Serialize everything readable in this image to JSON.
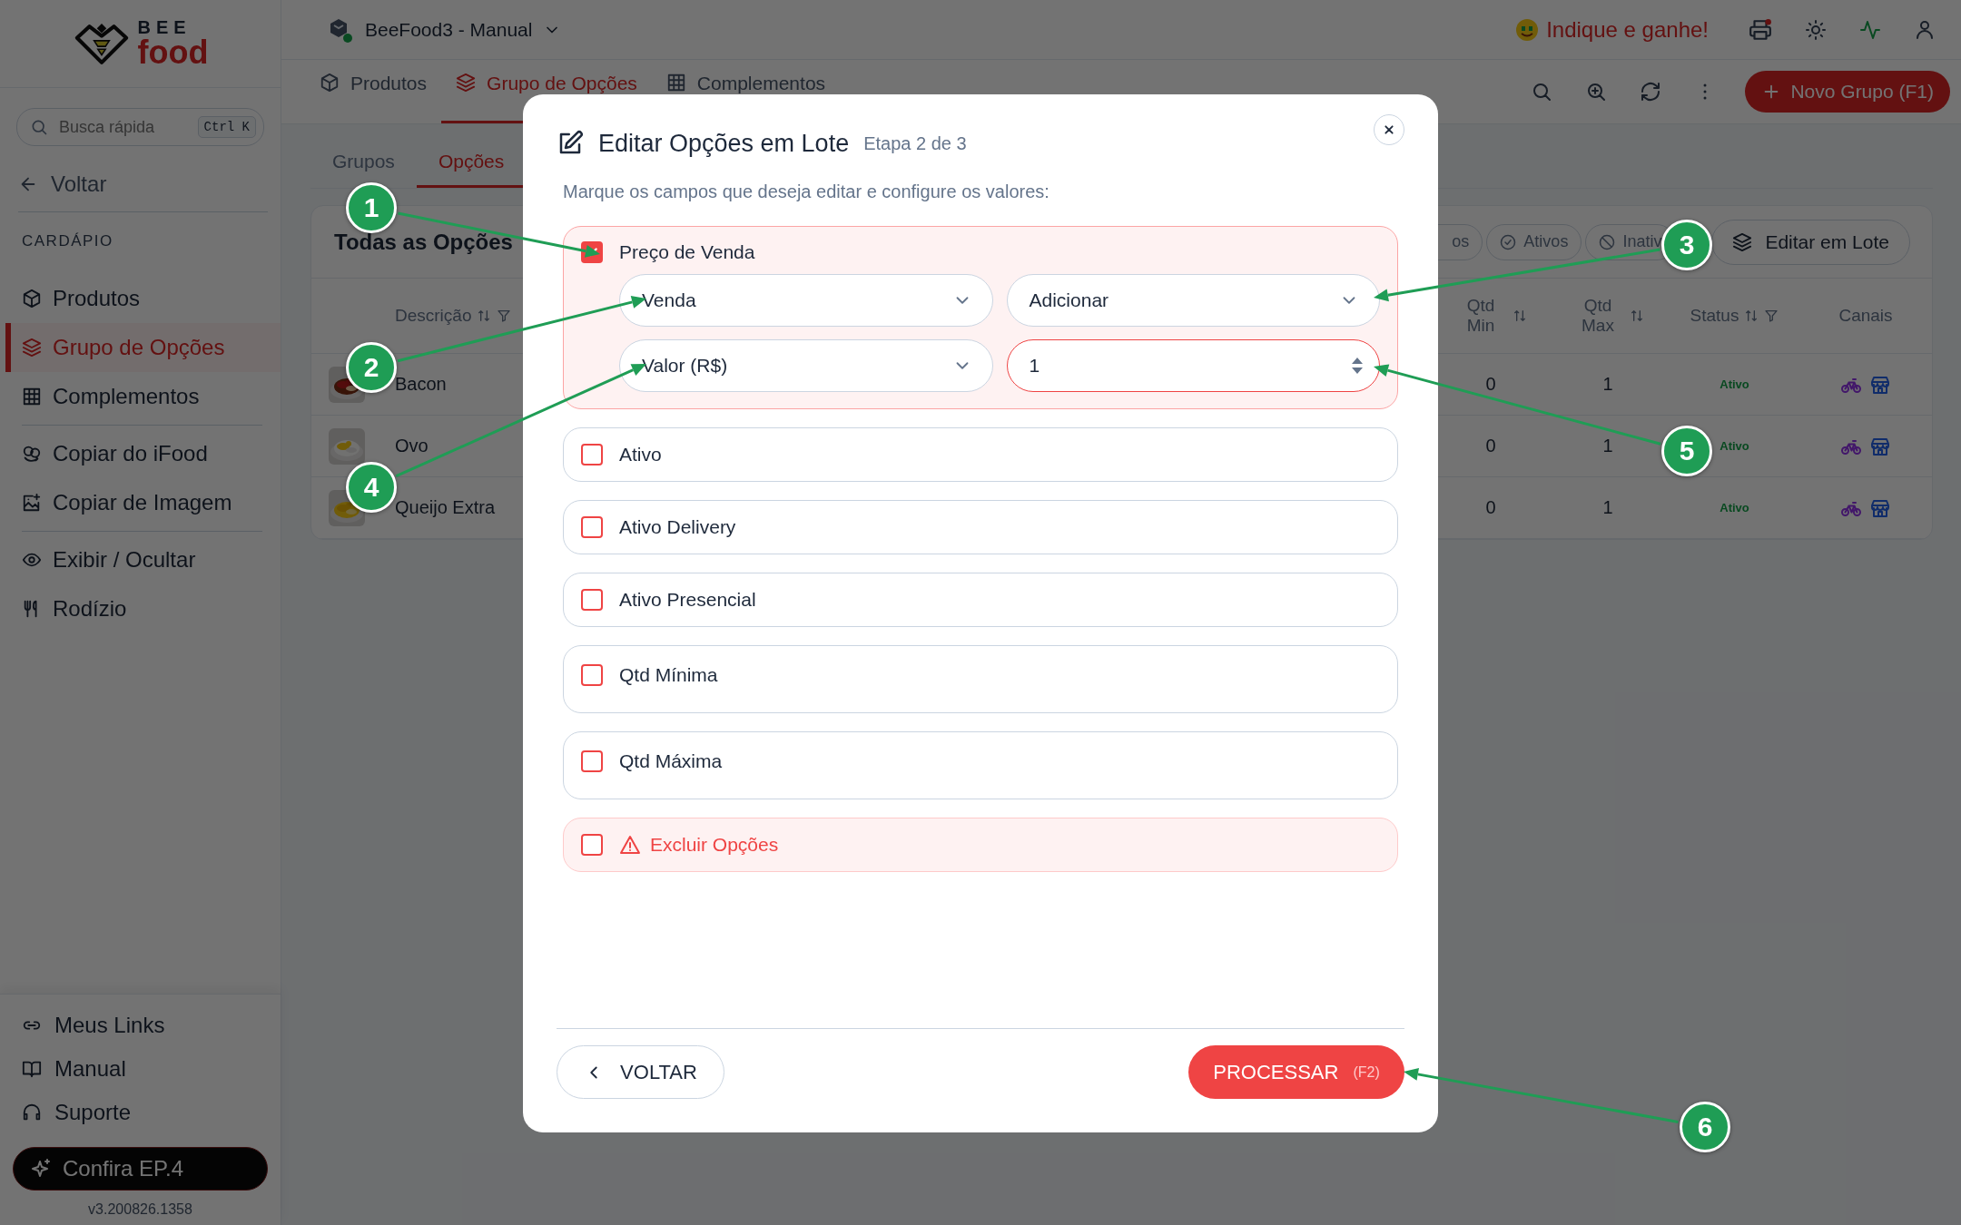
{
  "sidebar": {
    "logo": {
      "top": "BEE",
      "bottom": "food"
    },
    "search": {
      "placeholder": "Busca rápida",
      "shortcut": "Ctrl K"
    },
    "back": "Voltar",
    "section": "CARDÁPIO",
    "menu_groups": [
      {
        "items": [
          {
            "label": "Produtos",
            "selected": false
          },
          {
            "label": "Grupo de Opções",
            "selected": true
          },
          {
            "label": "Complementos",
            "selected": false
          }
        ]
      },
      {
        "items": [
          {
            "label": "Copiar do iFood",
            "selected": false
          },
          {
            "label": "Copiar de Imagem",
            "selected": false
          }
        ]
      },
      {
        "items": [
          {
            "label": "Exibir / Ocultar",
            "selected": false
          },
          {
            "label": "Rodízio",
            "selected": false
          }
        ]
      }
    ],
    "footer_links": [
      "Meus Links",
      "Manual",
      "Suporte"
    ],
    "promo": "Confira EP.4",
    "version": "v3.200826.1358"
  },
  "topbar": {
    "workspace": "BeeFood3 - Manual",
    "referral": "Indique e ganhe!"
  },
  "tabs": [
    {
      "label": "Produtos",
      "selected": false
    },
    {
      "label": "Grupo de Opções",
      "selected": true
    },
    {
      "label": "Complementos",
      "selected": false
    }
  ],
  "new_button": "Novo Grupo (F1)",
  "subtabs": [
    {
      "label": "Grupos",
      "selected": false
    },
    {
      "label": "Opções",
      "selected": true
    }
  ],
  "card": {
    "title": "Todas as Opções",
    "filters": [
      {
        "label": "os"
      },
      {
        "label": "Ativos"
      },
      {
        "label": "Inativ"
      }
    ],
    "batch_button": "Editar em Lote"
  },
  "table": {
    "columns": [
      "Descrição",
      "Qtd Min",
      "Qtd Max",
      "Status",
      "Canais"
    ],
    "rows": [
      {
        "name": "Bacon",
        "qtd_min": "0",
        "qtd_max": "1",
        "status": "Ativo"
      },
      {
        "name": "Ovo",
        "qtd_min": "0",
        "qtd_max": "1",
        "status": "Ativo"
      },
      {
        "name": "Queijo Extra",
        "qtd_min": "0",
        "qtd_max": "1",
        "status": "Ativo"
      }
    ]
  },
  "modal": {
    "title": "Editar Opções em Lote",
    "step": "Etapa 2 de 3",
    "instructions": "Marque os campos que deseja editar e configure os valores:",
    "fields": [
      {
        "kind": "price",
        "label": "Preço de Venda",
        "checked": true,
        "price_type": "Venda",
        "operation": "Adicionar",
        "unit": "Valor (R$)",
        "amount": "1"
      },
      {
        "kind": "plain",
        "label": "Ativo",
        "checked": false
      },
      {
        "kind": "plain",
        "label": "Ativo Delivery",
        "checked": false
      },
      {
        "kind": "plain",
        "label": "Ativo Presencial",
        "checked": false
      },
      {
        "kind": "quantity",
        "label": "Qtd Mínima",
        "checked": false
      },
      {
        "kind": "quantity",
        "label": "Qtd Máxima",
        "checked": false
      },
      {
        "kind": "danger",
        "label": "Excluir Opções",
        "checked": false
      }
    ],
    "back_button": "VOLTAR",
    "process_button": {
      "label": "PROCESSAR",
      "shortcut": "(F2)"
    }
  },
  "annotations": [
    {
      "label": "1"
    },
    {
      "label": "2"
    },
    {
      "label": "3"
    },
    {
      "label": "4"
    },
    {
      "label": "5"
    },
    {
      "label": "6"
    }
  ]
}
